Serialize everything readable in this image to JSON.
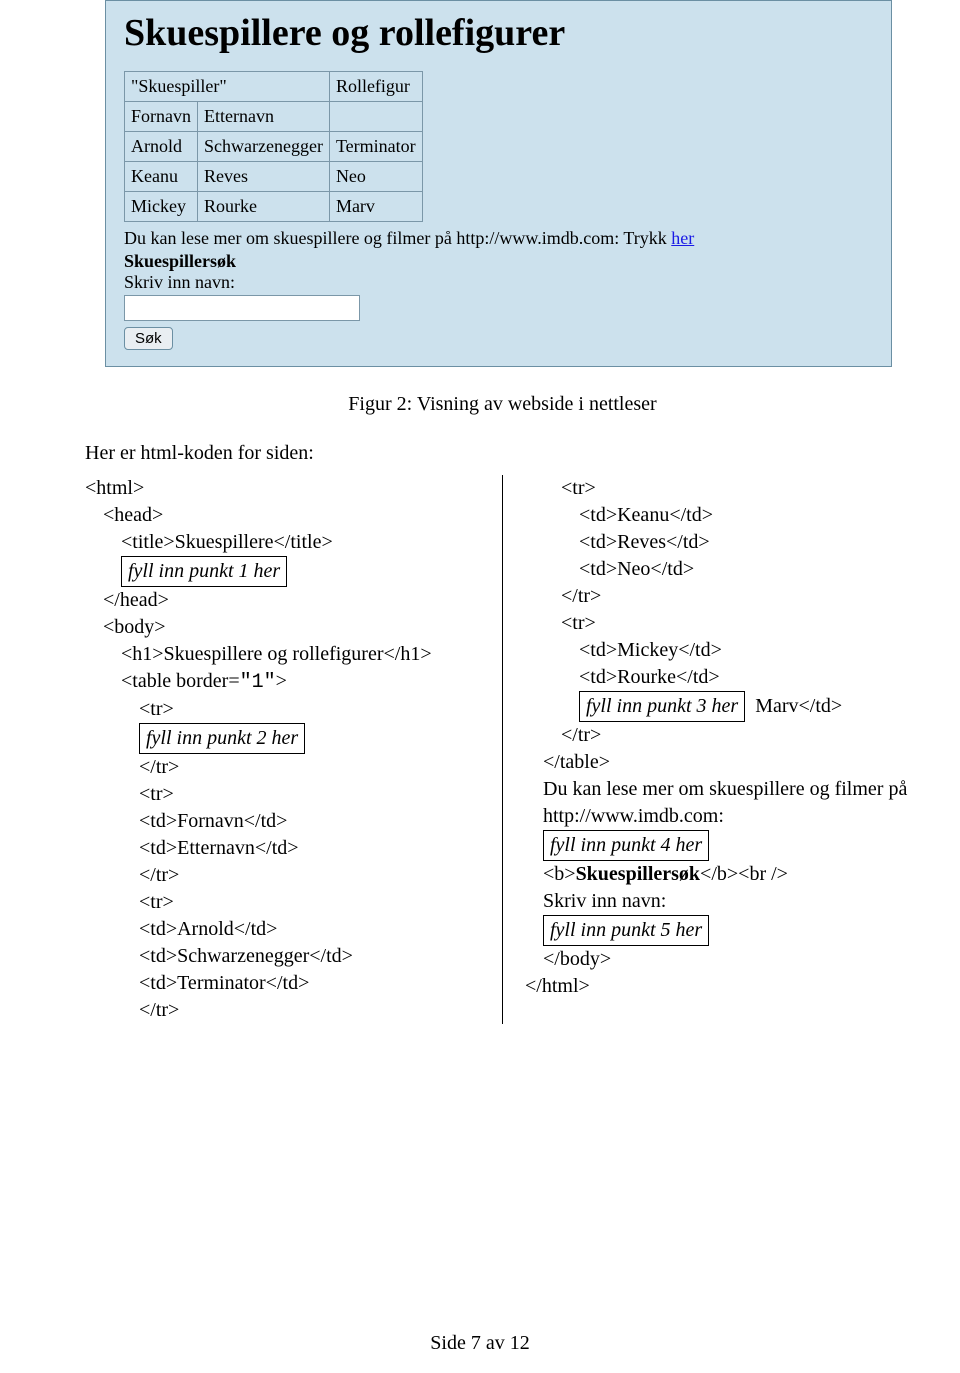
{
  "screenshot": {
    "heading": "Skuespillere og rollefigurer",
    "headers": {
      "actor": "\"Skuespiller\"",
      "role": "Rollefigur"
    },
    "subheaders": {
      "first": "Fornavn",
      "last": "Etternavn"
    },
    "rows": [
      {
        "first": "Arnold",
        "last": "Schwarzenegger",
        "role": "Terminator",
        "bold": false
      },
      {
        "first": "Keanu",
        "last": "Reves",
        "role": "Neo",
        "bold": false
      },
      {
        "first": "Mickey",
        "last": "Rourke",
        "role": "Marv",
        "bold": true
      }
    ],
    "info_text": "Du kan lese mer om skuespillere og filmer på http://www.imdb.com: Trykk ",
    "link_text": "her",
    "search_title": "Skuespillersøk",
    "search_label": "Skriv inn navn:",
    "button": "Søk"
  },
  "caption": "Figur 2: Visning av webside i nettleser",
  "intro": "Her er html-koden for siden:",
  "left": {
    "l1": "<html>",
    "l2": "<head>",
    "l3": "<title>Skuespillere</title>",
    "box1": "fyll inn punkt 1 her",
    "l4": "</head>",
    "l5": "<body>",
    "l6": "<h1>Skuespillere og rollefigurer</h1>",
    "l7a": "<table border=",
    "l7b": "\"1\"",
    "l7c": ">",
    "l8": "<tr>",
    "box2": "fyll inn punkt 2 her",
    "l9": "</tr>",
    "l10": "<tr>",
    "l11": "<td>Fornavn</td>",
    "l12": "<td>Etternavn</td>",
    "l13": "</tr>",
    "l14": "<tr>",
    "l15": "<td>Arnold</td>",
    "l16": "<td>Schwarzenegger</td>",
    "l17": "<td>Terminator</td>",
    "l18": "</tr>"
  },
  "right": {
    "r1": "<tr>",
    "r2": "<td>Keanu</td>",
    "r3": "<td>Reves</td>",
    "r4": "<td>Neo</td>",
    "r5": "</tr>",
    "r6": "<tr>",
    "r7": "<td>Mickey</td>",
    "r8": "<td>Rourke</td>",
    "box3": "fyll inn punkt 3 her",
    "r9": "Marv</td>",
    "r10": "</tr>",
    "r11": "</table>",
    "r12": "Du kan lese mer om skuespillere og filmer på http://www.imdb.com:",
    "box4": "fyll inn punkt 4 her",
    "r13a": "<b>",
    "r13b": "Skuespillersøk",
    "r13c": "</b><br />",
    "r14": "Skriv inn navn:",
    "box5": "fyll inn punkt 5 her",
    "r15": "</body>",
    "r16": "</html>"
  },
  "footer": "Side 7 av 12"
}
